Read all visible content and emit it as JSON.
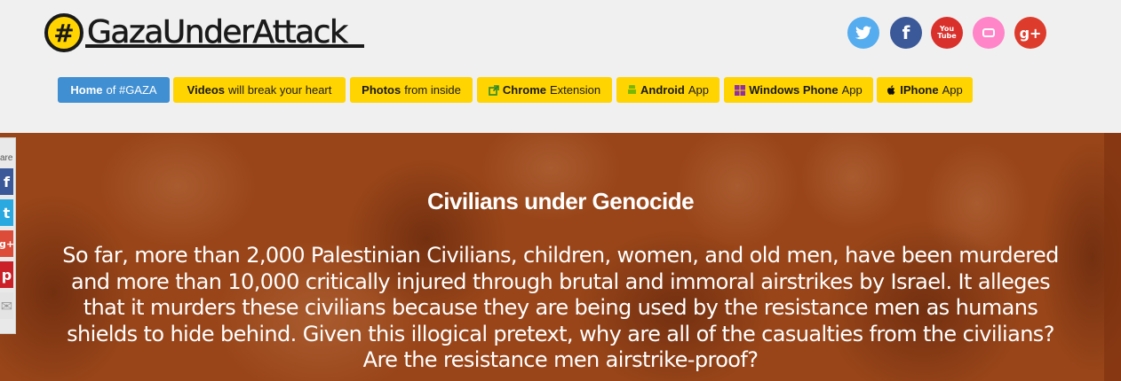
{
  "logo": {
    "hash": "#",
    "text": "GazaUnderAttack"
  },
  "social": [
    {
      "icon": "twitter-icon",
      "glyph": "t",
      "color": "#55acee"
    },
    {
      "icon": "facebook-icon",
      "glyph": "f",
      "color": "#3b5998"
    },
    {
      "icon": "youtube-icon",
      "glyph": "You Tube",
      "color": "#d9302c"
    },
    {
      "icon": "flickr-icon",
      "glyph": "••",
      "color": "#ff84c8"
    },
    {
      "icon": "google-plus-icon",
      "glyph": "g+",
      "color": "#dd3b2c"
    }
  ],
  "nav": {
    "home": {
      "bold": "Home",
      "rest": "of #GAZA"
    },
    "videos": {
      "bold": "Videos",
      "rest": "will break your heart"
    },
    "photos": {
      "bold": "Photos",
      "rest": "from inside"
    },
    "chrome": {
      "bold": "Chrome",
      "rest": "Extension",
      "icon": "external-link-icon"
    },
    "android": {
      "bold": "Android",
      "rest": "App",
      "icon": "android-icon"
    },
    "windows": {
      "bold": "Windows Phone",
      "rest": "App",
      "icon": "windows-icon"
    },
    "iphone": {
      "bold": "IPhone",
      "rest": "App",
      "icon": "apple-icon"
    }
  },
  "colors": {
    "nav_yellow": "#ffd400",
    "nav_active": "#3f8fd2",
    "hero_tint": "#a3521f"
  },
  "share": {
    "label": "are",
    "buttons": [
      {
        "icon": "facebook-icon",
        "glyph": "f",
        "color": "#3b5998"
      },
      {
        "icon": "twitter-icon",
        "glyph": "t",
        "color": "#2aa9e0"
      },
      {
        "icon": "google-plus-icon",
        "glyph": "g+",
        "color": "#dd4b39"
      },
      {
        "icon": "pinterest-icon",
        "glyph": "p",
        "color": "#cb2027"
      },
      {
        "icon": "email-icon",
        "glyph": "✉",
        "color": "#e4e4e4"
      }
    ]
  },
  "hero": {
    "title": "Civilians under Genocide",
    "body": "So far, more than 2,000 Palestinian Civilians, children, women, and old men, have been murdered and more than 10,000 critically injured through brutal and immoral airstrikes by Israel. It alleges that it murders these civilians because they are being used by the resistance men as humans shields to hide behind. Given this illogical pretext, why are all of the casualties from the civilians? Are the resistance men airstrike-proof?"
  }
}
